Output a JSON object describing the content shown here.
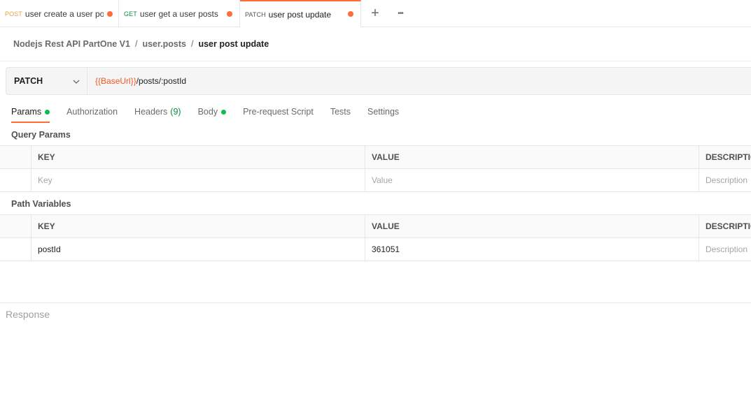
{
  "tabs": [
    {
      "method": "POST",
      "name": "user create a user po",
      "unsaved": true
    },
    {
      "method": "GET",
      "name": "user get a user posts",
      "unsaved": true
    },
    {
      "method": "PATCH",
      "name": "user post update",
      "unsaved": true,
      "active": true
    }
  ],
  "tab_actions": {
    "new_tab_icon": "+",
    "more_icon": "•••"
  },
  "breadcrumb": {
    "collection": "Nodejs Rest API PartOne V1",
    "folder": "user.posts",
    "request": "user post update",
    "separator": "/"
  },
  "request": {
    "method": "PATCH",
    "url_variable": "{{BaseUrl}}",
    "url_path": "/posts/:postId"
  },
  "request_tabs": [
    {
      "label": "Params",
      "dot": true,
      "active": true
    },
    {
      "label": "Authorization"
    },
    {
      "label": "Headers",
      "count": "(9)"
    },
    {
      "label": "Body",
      "dot": true
    },
    {
      "label": "Pre-request Script"
    },
    {
      "label": "Tests"
    },
    {
      "label": "Settings"
    }
  ],
  "query_params": {
    "title": "Query Params",
    "columns": [
      "KEY",
      "VALUE",
      "DESCRIPTION"
    ],
    "placeholders": {
      "key": "Key",
      "value": "Value",
      "description": "Description"
    }
  },
  "path_variables": {
    "title": "Path Variables",
    "columns": [
      "KEY",
      "VALUE",
      "DESCRIPTION"
    ],
    "rows": [
      {
        "key": "postId",
        "value": "361051",
        "description_placeholder": "Description"
      }
    ]
  },
  "response": {
    "label": "Response"
  },
  "colors": {
    "accent": "#ff6c37",
    "post": "#e6a23c",
    "get": "#0c8a3e",
    "status_dot": "#0cbb52",
    "url_var": "#f15a24"
  }
}
